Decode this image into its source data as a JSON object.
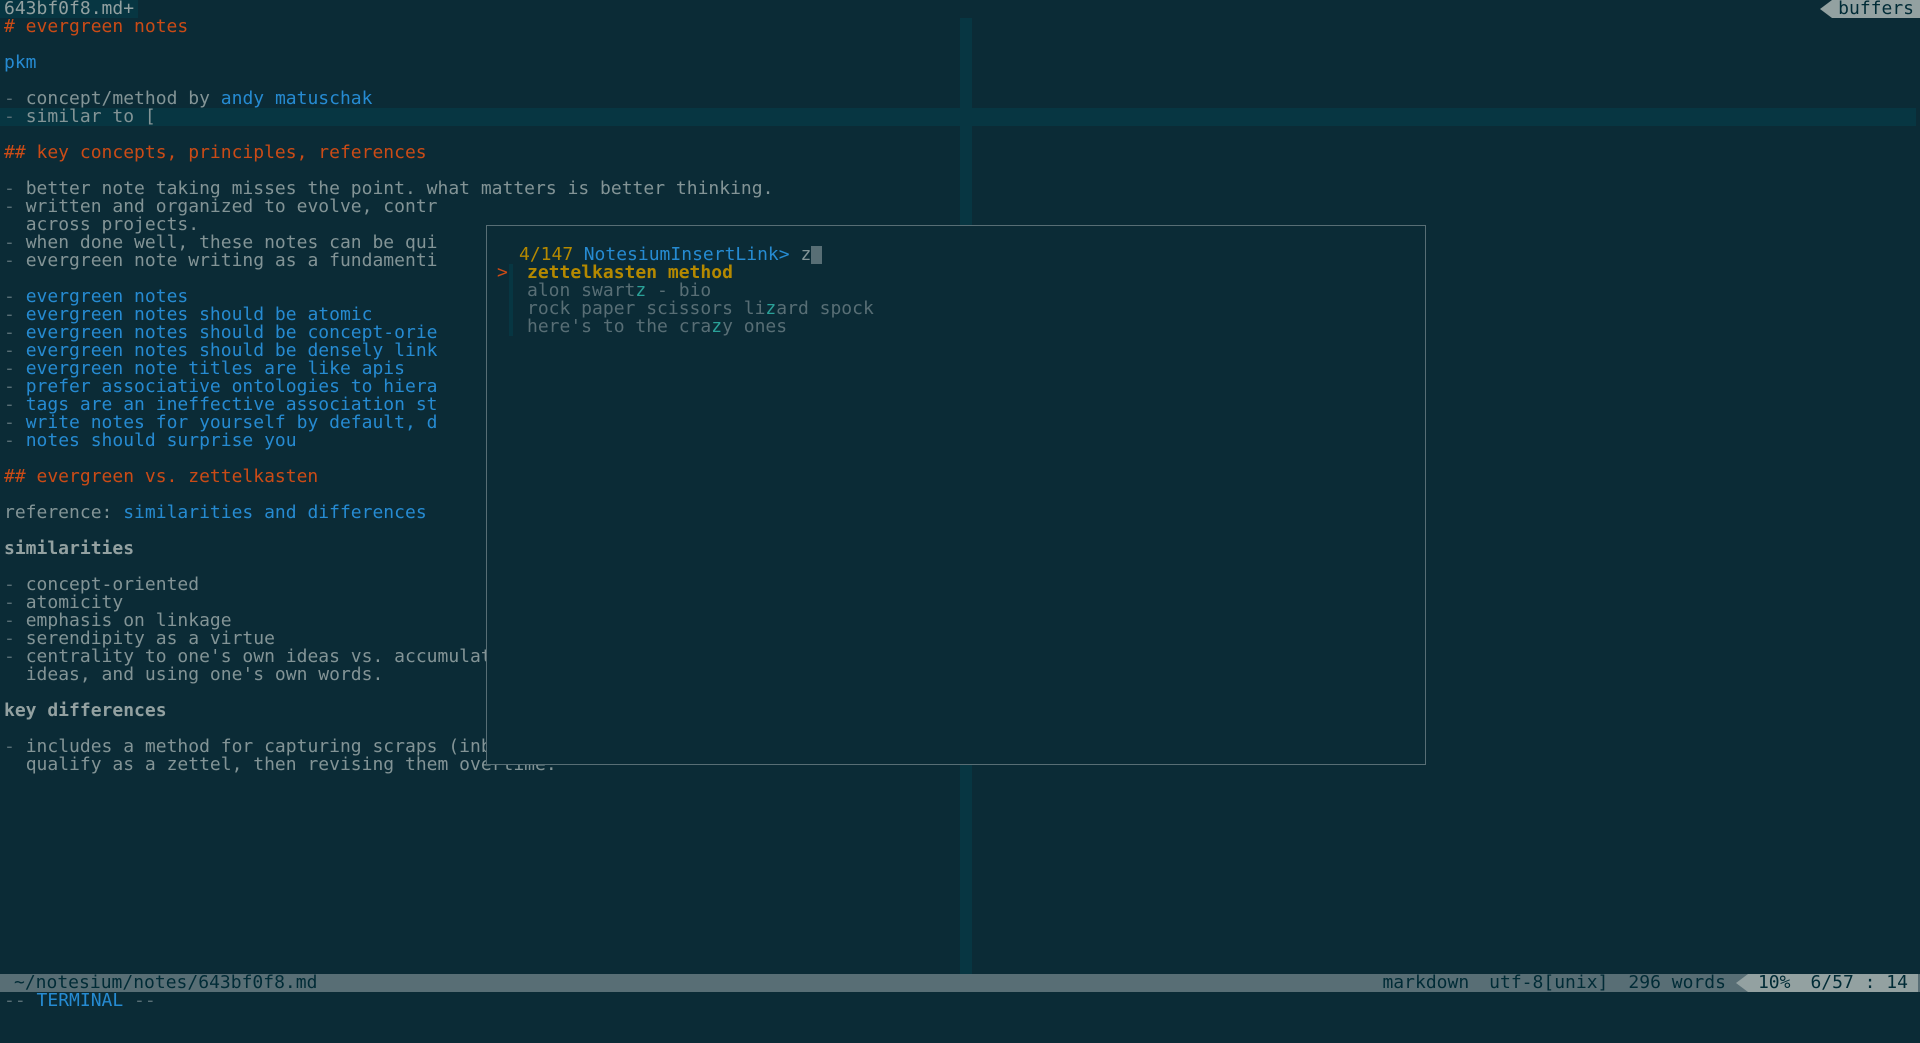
{
  "tabline": {
    "active_tab": "643bf0f8.md+",
    "buffers_label": "buffers"
  },
  "editor": {
    "h1": "# evergreen notes",
    "link_pkm": "pkm",
    "l_concept_pre": "concept/method by ",
    "l_concept_link": "andy matuschak",
    "l_similar": "similar to [",
    "h2a": "## key concepts, principles, references",
    "kc1": "better note taking misses the point. what matters is better thinking.",
    "kc2": "written and organized to evolve, contr",
    "kc2b": "across projects.",
    "kc3": "when done well, these notes can be qui",
    "kc4": "evergreen note writing as a fundamenti",
    "li1": "evergreen notes",
    "li2": "evergreen notes should be atomic",
    "li3": "evergreen notes should be concept-orie",
    "li4": "evergreen notes should be densely link",
    "li5": "evergreen note titles are like apis",
    "li6": "prefer associative ontologies to hiera",
    "li7": "tags are an ineffective association st",
    "li8": "write notes for yourself by default, d",
    "li9": "notes should surprise you",
    "h2b": "## evergreen vs. zettelkasten",
    "ref_pre": "reference: ",
    "ref_link": "similarities and differences",
    "sim_head": "similarities",
    "sim1": "concept-oriented",
    "sim2": "atomicity",
    "sim3": "emphasis on linkage",
    "sim4": "serendipity as a virtue",
    "sim5": "centrality to one's own ideas vs. accumulating summaries of others",
    "sim5b": "ideas, and using one's own words.",
    "diff_head": "key differences",
    "diff1": "includes a method for capturing scraps (inbox) which would not yet",
    "diff1b": "qualify as a zettel, then revising them overtime."
  },
  "popup": {
    "prompt": "NotesiumInsertLink> ",
    "query": "z",
    "count": "4/147",
    "results": [
      {
        "pre": "",
        "match": "z",
        "post": "ettelkasten method",
        "selected": true
      },
      {
        "pre": "alon swart",
        "match": "z",
        "post": " - bio",
        "selected": false
      },
      {
        "pre": "rock paper scissors li",
        "match": "z",
        "post": "ard spock",
        "selected": false
      },
      {
        "pre": "here's to the cra",
        "match": "z",
        "post": "y ones",
        "selected": false
      }
    ]
  },
  "status": {
    "filepath": "~/notesium/notes/643bf0f8.md",
    "filetype": "markdown",
    "encoding": "utf-8[unix]",
    "wordcount": "296 words",
    "percent": "10%",
    "pos": "6/57 : 14"
  },
  "cmdline": {
    "mode": "TERMINAL"
  }
}
